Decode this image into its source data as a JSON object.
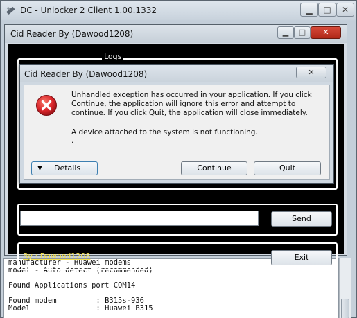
{
  "dc_window": {
    "title": "DC - Unlocker 2 Client 1.00.1332",
    "console_lines": [
      "manufacturer - Huawei modems",
      "model - Auto detect (recommended)",
      "",
      "Found Applications port COM14",
      "",
      "Found modem         : B315s-936",
      "Model               : Huawei B315"
    ]
  },
  "cid_window": {
    "title": "Cid Reader By (Dawood1208)",
    "logs_label": "Logs",
    "command_value": "",
    "send_label": "Send",
    "author_link": "By : Dawood1208",
    "exit_label": "Exit"
  },
  "dialog": {
    "title": "Cid Reader By (Dawood1208)",
    "message": "Unhandled exception has occurred in your application. If you click Continue, the application will ignore this error and attempt to continue. If you click Quit, the application will close immediately.",
    "detail": "A device attached to the system is not functioning.",
    "dot": ".",
    "details_label": "Details",
    "continue_label": "Continue",
    "quit_label": "Quit"
  },
  "colors": {
    "author_link": "#f4e04a",
    "error_red": "#d9252a",
    "focus_blue": "#3c7fb1"
  },
  "icons": [
    "app-icon",
    "minimize-icon",
    "maximize-icon",
    "close-icon",
    "error-icon",
    "expand-triangle-icon"
  ]
}
